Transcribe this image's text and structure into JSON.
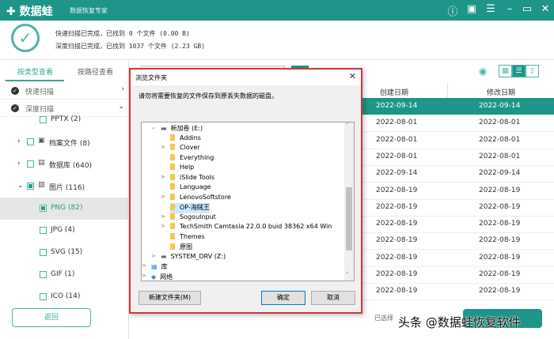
{
  "app": {
    "name": "数据蛙",
    "subtitle": "数据恢复专家"
  },
  "titlebar_icons": [
    "help-icon",
    "save-icon",
    "menu-icon",
    "minimize-icon",
    "maximize-icon",
    "close-icon"
  ],
  "header": {
    "quick_line": "快速扫描已完成，已找到 0 个文件 (0.00  B)",
    "deep_line": "深度扫描已完成，已找到 1037 个文件 (2.23 GB)"
  },
  "left": {
    "tabs": [
      "按类型查看",
      "按路径查看"
    ],
    "scans": [
      {
        "label": "快速扫描",
        "chev": "›"
      },
      {
        "label": "深度扫描",
        "chev": "⌄"
      }
    ],
    "tree": [
      {
        "label": "PPTX (2)",
        "level": 2,
        "checked": false
      },
      {
        "label": "档案文件 (8)",
        "level": 1,
        "checked": false,
        "arrow": "›",
        "icon": "▣"
      },
      {
        "label": "数据库 (640)",
        "level": 1,
        "checked": false,
        "arrow": "›",
        "icon": "▤"
      },
      {
        "label": "图片 (116)",
        "level": 1,
        "checked": true,
        "arrow": "⌄",
        "icon": "▨"
      },
      {
        "label": "PNG (82)",
        "level": 2,
        "checked": true,
        "selected": true
      },
      {
        "label": "JPG (4)",
        "level": 2,
        "checked": false
      },
      {
        "label": "SVG (15)",
        "level": 2,
        "checked": false
      },
      {
        "label": "GIF (1)",
        "level": 2,
        "checked": false
      },
      {
        "label": "ICO (14)",
        "level": 2,
        "checked": false
      }
    ],
    "back": "返回"
  },
  "table": {
    "headers": [
      "创建日期",
      "修改日期"
    ],
    "rows": [
      [
        "2022-09-14",
        "2022-09-14"
      ],
      [
        "2022-08-01",
        "2022-08-01"
      ],
      [
        "2022-08-01",
        "2022-08-01"
      ],
      [
        "2022-08-01",
        "2022-08-01"
      ],
      [
        "2022-09-14",
        "2022-09-14"
      ],
      [
        "2022-08-19",
        "2022-08-19"
      ],
      [
        "2022-08-19",
        "2022-08-19"
      ],
      [
        "2022-08-19",
        "2022-08-19"
      ],
      [
        "2022-08-19",
        "2022-08-19"
      ],
      [
        "2022-08-19",
        "2022-08-19"
      ],
      [
        "2022-08-19",
        "2022-08-19"
      ],
      [
        "2022-08-19",
        "2022-08-19"
      ]
    ]
  },
  "footer": {
    "selected": "已选择"
  },
  "watermark": "头条 @数据蛙恢复软件",
  "dialog": {
    "title": "浏览文件夹",
    "message": "请勿将需要恢复的文件保存到原丢失数据的磁盘。",
    "items": [
      {
        "label": "新加卷 (E:)",
        "indent": 1,
        "ex": "⌄",
        "type": "drive"
      },
      {
        "label": "Addins",
        "indent": 2,
        "type": "folder"
      },
      {
        "label": "Clover",
        "indent": 2,
        "ex": ">",
        "type": "folder"
      },
      {
        "label": "Everything",
        "indent": 2,
        "type": "folder"
      },
      {
        "label": "Help",
        "indent": 2,
        "type": "folder"
      },
      {
        "label": "iSlide Tools",
        "indent": 2,
        "ex": ">",
        "type": "folder"
      },
      {
        "label": "Language",
        "indent": 2,
        "type": "folder"
      },
      {
        "label": "LenovoSoftstore",
        "indent": 2,
        "ex": ">",
        "type": "folder"
      },
      {
        "label": "OP-海贼王",
        "indent": 2,
        "type": "folder",
        "selected": true
      },
      {
        "label": "SogouInput",
        "indent": 2,
        "ex": ">",
        "type": "folder"
      },
      {
        "label": "TechSmith Camtasia 22.0.0 buid 38362 x64 Win",
        "indent": 2,
        "ex": ">",
        "type": "folder"
      },
      {
        "label": "Themes",
        "indent": 2,
        "type": "folder"
      },
      {
        "label": "原图",
        "indent": 2,
        "type": "folder"
      },
      {
        "label": "SYSTEM_DRV (Z:)",
        "indent": 1,
        "ex": ">",
        "type": "drive"
      },
      {
        "label": "库",
        "indent": 0,
        "ex": ">",
        "type": "library"
      },
      {
        "label": "网络",
        "indent": 0,
        "ex": ">",
        "type": "network"
      }
    ],
    "new_folder": "新建文件夹(M)",
    "ok": "确定",
    "cancel": "取消"
  },
  "colors": {
    "accent": "#1e9588",
    "dialog_border": "#d0363c"
  }
}
